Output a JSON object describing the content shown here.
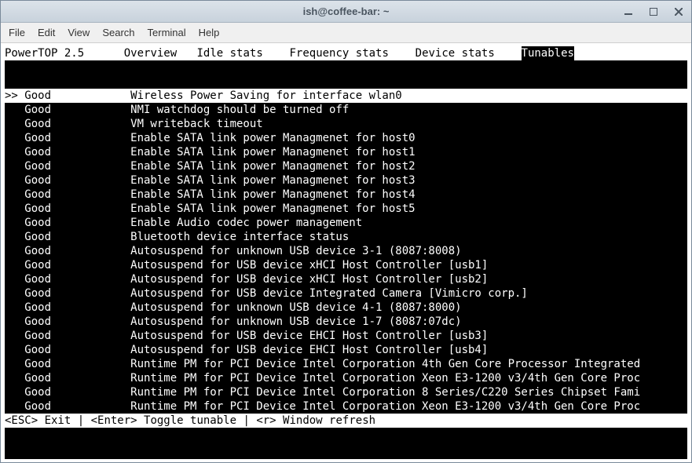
{
  "window": {
    "title": "ish@coffee-bar: ~"
  },
  "menu": {
    "file": "File",
    "edit": "Edit",
    "view": "View",
    "search": "Search",
    "terminal": "Terminal",
    "help": "Help"
  },
  "app_name": "PowerTOP 2.5",
  "tabs": {
    "overview": "Overview",
    "idle": "Idle stats",
    "frequency": "Frequency stats",
    "device": "Device stats",
    "tunables": "Tunables"
  },
  "active_tab": "tunables",
  "rows": [
    {
      "selected": true,
      "status": "Good",
      "desc": "Wireless Power Saving for interface wlan0"
    },
    {
      "selected": false,
      "status": "Good",
      "desc": "NMI watchdog should be turned off"
    },
    {
      "selected": false,
      "status": "Good",
      "desc": "VM writeback timeout"
    },
    {
      "selected": false,
      "status": "Good",
      "desc": "Enable SATA link power Managmenet for host0"
    },
    {
      "selected": false,
      "status": "Good",
      "desc": "Enable SATA link power Managmenet for host1"
    },
    {
      "selected": false,
      "status": "Good",
      "desc": "Enable SATA link power Managmenet for host2"
    },
    {
      "selected": false,
      "status": "Good",
      "desc": "Enable SATA link power Managmenet for host3"
    },
    {
      "selected": false,
      "status": "Good",
      "desc": "Enable SATA link power Managmenet for host4"
    },
    {
      "selected": false,
      "status": "Good",
      "desc": "Enable SATA link power Managmenet for host5"
    },
    {
      "selected": false,
      "status": "Good",
      "desc": "Enable Audio codec power management"
    },
    {
      "selected": false,
      "status": "Good",
      "desc": "Bluetooth device interface status"
    },
    {
      "selected": false,
      "status": "Good",
      "desc": "Autosuspend for unknown USB device 3-1 (8087:8008)"
    },
    {
      "selected": false,
      "status": "Good",
      "desc": "Autosuspend for USB device xHCI Host Controller [usb1]"
    },
    {
      "selected": false,
      "status": "Good",
      "desc": "Autosuspend for USB device xHCI Host Controller [usb2]"
    },
    {
      "selected": false,
      "status": "Good",
      "desc": "Autosuspend for USB device Integrated Camera [Vimicro corp.]"
    },
    {
      "selected": false,
      "status": "Good",
      "desc": "Autosuspend for unknown USB device 4-1 (8087:8000)"
    },
    {
      "selected": false,
      "status": "Good",
      "desc": "Autosuspend for unknown USB device 1-7 (8087:07dc)"
    },
    {
      "selected": false,
      "status": "Good",
      "desc": "Autosuspend for USB device EHCI Host Controller [usb3]"
    },
    {
      "selected": false,
      "status": "Good",
      "desc": "Autosuspend for USB device EHCI Host Controller [usb4]"
    },
    {
      "selected": false,
      "status": "Good",
      "desc": "Runtime PM for PCI Device Intel Corporation 4th Gen Core Processor Integrated"
    },
    {
      "selected": false,
      "status": "Good",
      "desc": "Runtime PM for PCI Device Intel Corporation Xeon E3-1200 v3/4th Gen Core Proc"
    },
    {
      "selected": false,
      "status": "Good",
      "desc": "Runtime PM for PCI Device Intel Corporation 8 Series/C220 Series Chipset Fami"
    },
    {
      "selected": false,
      "status": "Good",
      "desc": "Runtime PM for PCI Device Intel Corporation Xeon E3-1200 v3/4th Gen Core Proc"
    }
  ],
  "footer": {
    "esc": "<ESC> Exit",
    "enter": "<Enter> Toggle tunable",
    "r": "<r> Window refresh"
  }
}
